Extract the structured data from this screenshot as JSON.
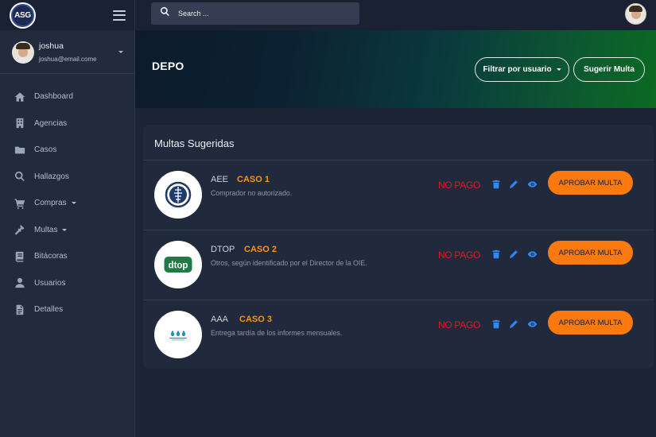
{
  "brand": {
    "logo_text": "ASG"
  },
  "user": {
    "name": "joshua",
    "email": "joshua@email.come"
  },
  "sidebar": {
    "items": [
      {
        "label": "Dashboard",
        "icon": "home-icon"
      },
      {
        "label": "Agencias",
        "icon": "building-icon"
      },
      {
        "label": "Casos",
        "icon": "folder-icon"
      },
      {
        "label": "Hallazgos",
        "icon": "search-icon"
      },
      {
        "label": "Compras",
        "icon": "cart-icon",
        "dropdown": true
      },
      {
        "label": "Multas",
        "icon": "gavel-icon",
        "dropdown": true
      },
      {
        "label": "Bitácoras",
        "icon": "book-icon"
      },
      {
        "label": "Usuarios",
        "icon": "user-icon"
      },
      {
        "label": "Detalles",
        "icon": "file-icon"
      }
    ]
  },
  "search": {
    "placeholder": "Search ..."
  },
  "header": {
    "title": "DEPO",
    "filter_label": "Filtrar por usuario",
    "suggest_label": "Sugerir Multa"
  },
  "card": {
    "title": "Multas Sugeridas",
    "rows": [
      {
        "agency": "AEE",
        "case": "CASO 1",
        "description": "Comprador no autorizado.",
        "status": "NO PAGO",
        "action": "APROBAR MULTA",
        "logo": "aee-logo"
      },
      {
        "agency": "DTOP",
        "case": "CASO 2",
        "description": "Otros, según identificado por el Director de la OIE.",
        "status": "NO PAGO",
        "action": "APROBAR MULTA",
        "logo": "dtop-logo"
      },
      {
        "agency": "AAA",
        "case": "CASO 3",
        "description": "Entrega tardía de los informes mensuales.",
        "status": "NO PAGO",
        "action": "APROBAR MULTA",
        "logo": "aaa-logo"
      }
    ]
  },
  "colors": {
    "accent": "#fb7a0f",
    "case_label": "#f7931e",
    "status_unpaid": "#e8161e",
    "icon_blue": "#2e86f0",
    "dtop_green": "#1f7a46",
    "aee_navy": "#1d3c68"
  }
}
